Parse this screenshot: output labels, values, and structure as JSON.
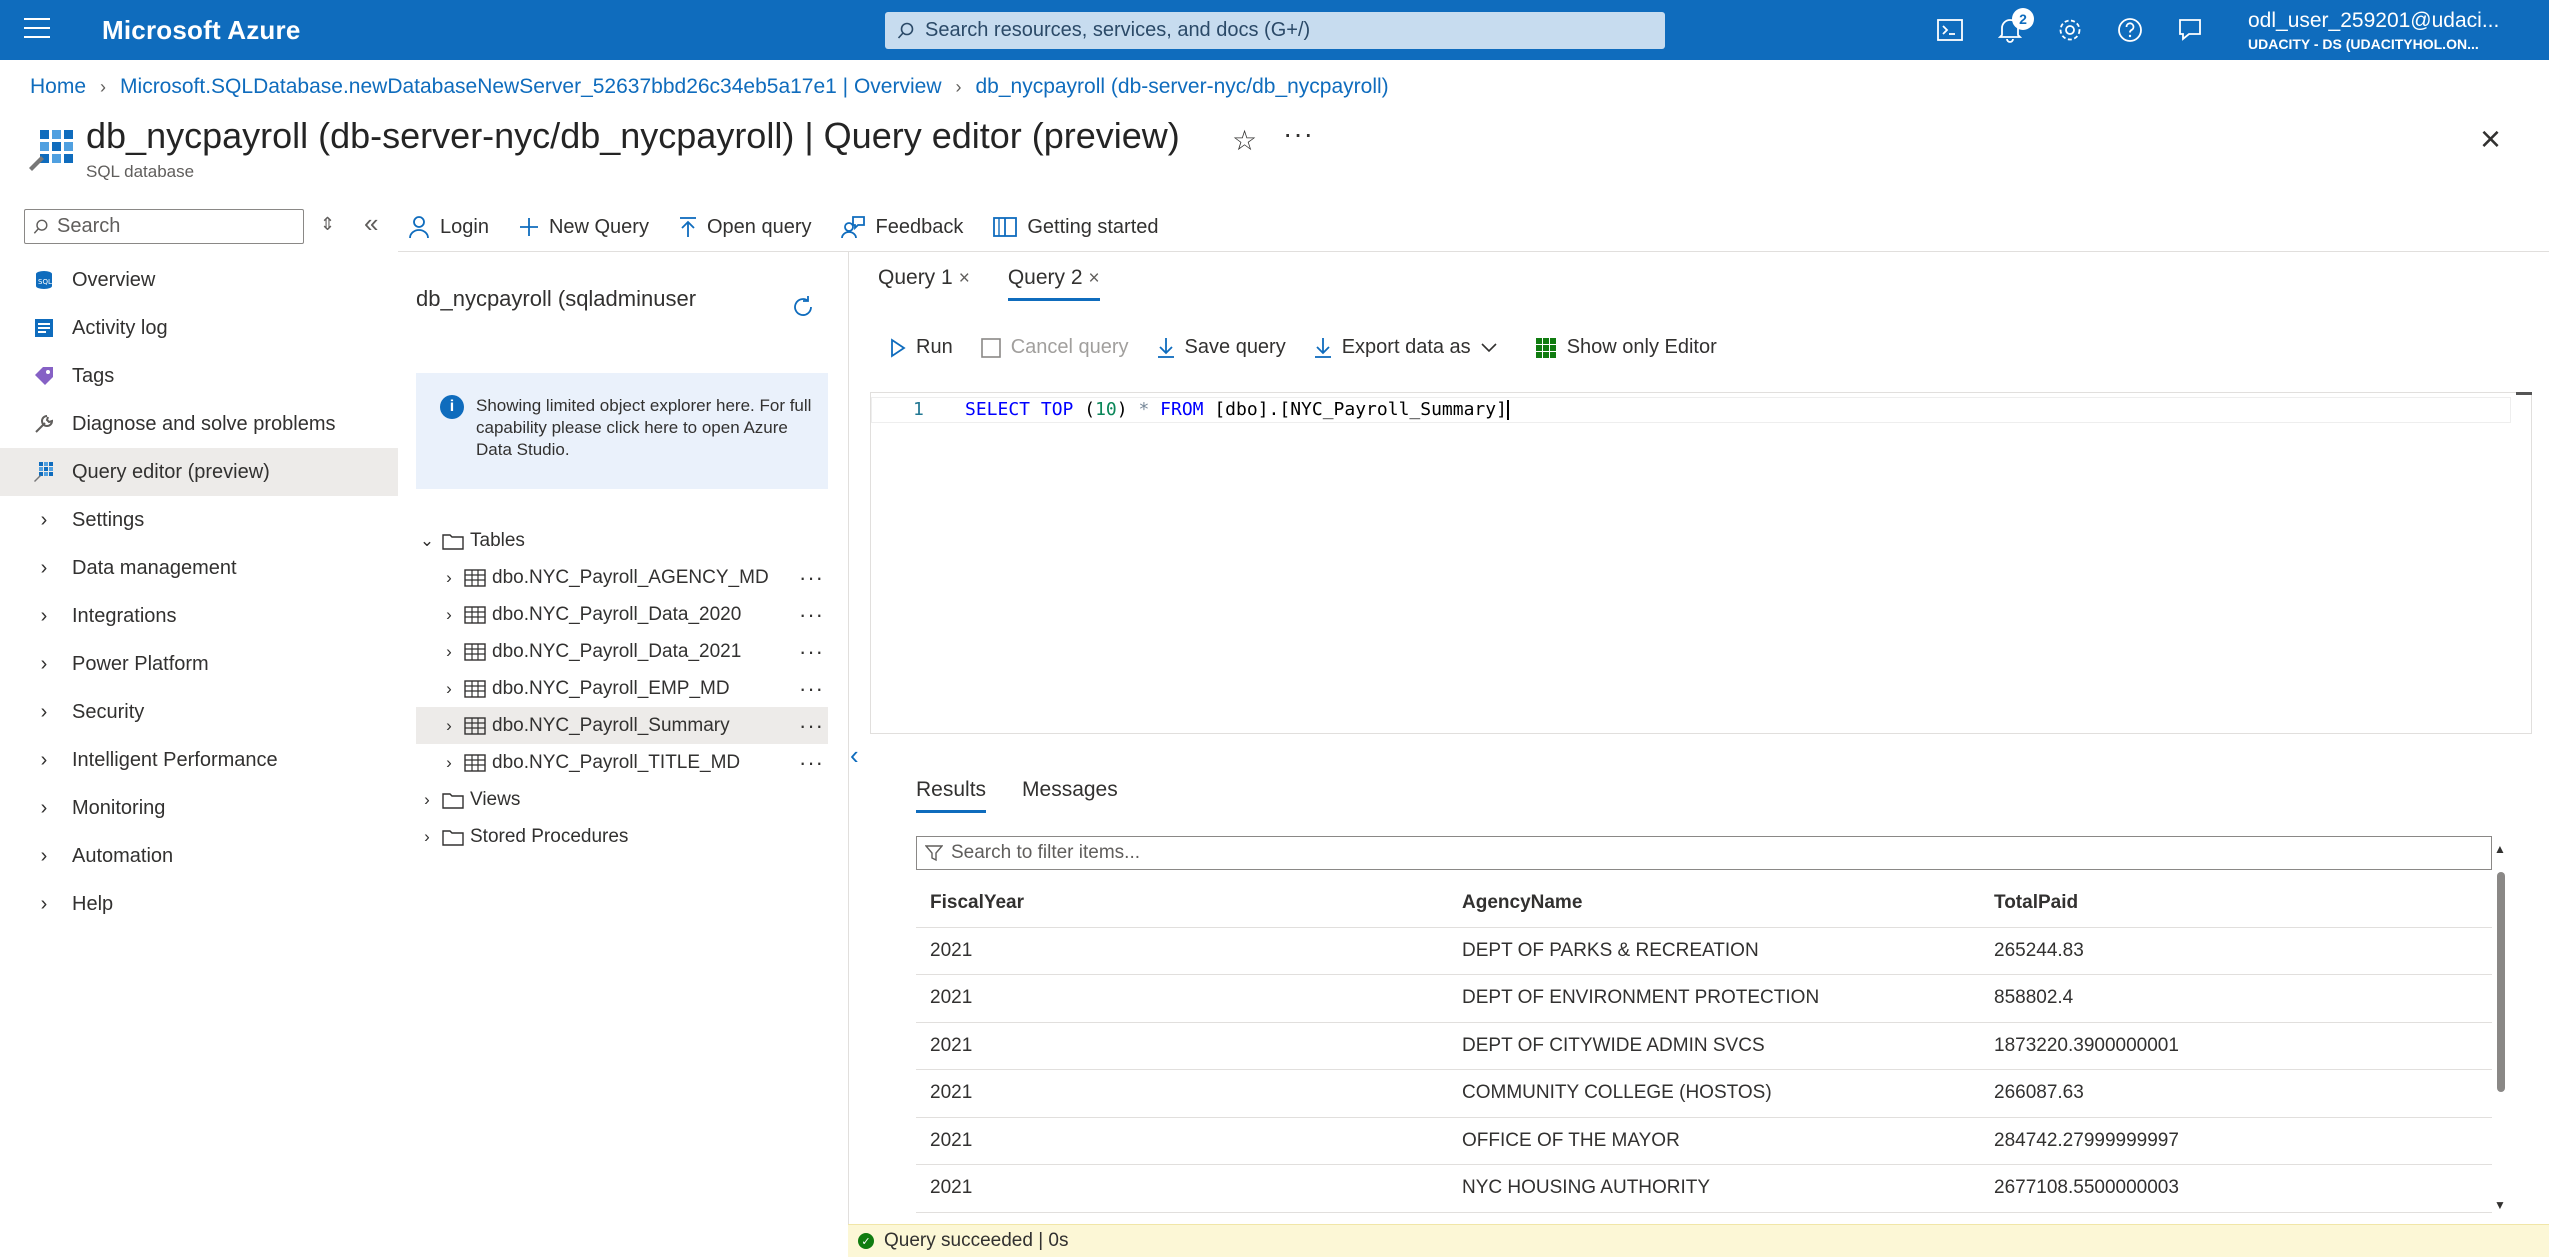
{
  "topbar": {
    "brand": "Microsoft Azure",
    "search_placeholder": "Search resources, services, and docs (G+/)",
    "notification_count": "2",
    "user": "odl_user_259201@udaci...",
    "tenant": "UDACITY - DS (UDACITYHOL.ON..."
  },
  "breadcrumb": {
    "home": "Home",
    "server": "Microsoft.SQLDatabase.newDatabaseNewServer_52637bbd26c34eb5a17e1 | Overview",
    "db": "db_nycpayroll (db-server-nyc/db_nycpayroll)"
  },
  "header": {
    "title": "db_nycpayroll (db-server-nyc/db_nycpayroll) | Query editor (preview)",
    "subtitle": "SQL database"
  },
  "nav": {
    "search_placeholder": "Search",
    "items": [
      {
        "label": "Overview"
      },
      {
        "label": "Activity log"
      },
      {
        "label": "Tags"
      },
      {
        "label": "Diagnose and solve problems"
      },
      {
        "label": "Query editor (preview)"
      },
      {
        "label": "Settings"
      },
      {
        "label": "Data management"
      },
      {
        "label": "Integrations"
      },
      {
        "label": "Power Platform"
      },
      {
        "label": "Security"
      },
      {
        "label": "Intelligent Performance"
      },
      {
        "label": "Monitoring"
      },
      {
        "label": "Automation"
      },
      {
        "label": "Help"
      }
    ]
  },
  "toolbar": {
    "login": "Login",
    "new_query": "New Query",
    "open_query": "Open query",
    "feedback": "Feedback",
    "getting_started": "Getting started"
  },
  "explorer": {
    "title": "db_nycpayroll (sqladminuser",
    "info": "Showing limited object explorer here. For full capability please click here to open Azure Data Studio.",
    "tables_label": "Tables",
    "tables": [
      {
        "name": "dbo.NYC_Payroll_AGENCY_MD"
      },
      {
        "name": "dbo.NYC_Payroll_Data_2020"
      },
      {
        "name": "dbo.NYC_Payroll_Data_2021"
      },
      {
        "name": "dbo.NYC_Payroll_EMP_MD"
      },
      {
        "name": "dbo.NYC_Payroll_Summary"
      },
      {
        "name": "dbo.NYC_Payroll_TITLE_MD"
      }
    ],
    "views_label": "Views",
    "procs_label": "Stored Procedures"
  },
  "query_tabs": [
    {
      "label": "Query 1"
    },
    {
      "label": "Query 2"
    }
  ],
  "query_toolbar": {
    "run": "Run",
    "cancel": "Cancel query",
    "save": "Save query",
    "export": "Export data as",
    "show_editor": "Show only Editor"
  },
  "editor": {
    "line_number": "1",
    "kw_select": "SELECT",
    "kw_top": "TOP",
    "paren_open": "(",
    "num": "10",
    "paren_close": ")",
    "star": "*",
    "kw_from": "FROM",
    "object": "[dbo].[NYC_Payroll_Summary]"
  },
  "results": {
    "tab_results": "Results",
    "tab_messages": "Messages",
    "filter_placeholder": "Search to filter items...",
    "columns": [
      "FiscalYear",
      "AgencyName",
      "TotalPaid"
    ],
    "rows": [
      [
        "2021",
        "DEPT OF PARKS & RECREATION",
        "265244.83"
      ],
      [
        "2021",
        "DEPT OF ENVIRONMENT PROTECTION",
        "858802.4"
      ],
      [
        "2021",
        "DEPT OF CITYWIDE ADMIN SVCS",
        "1873220.3900000001"
      ],
      [
        "2021",
        "COMMUNITY COLLEGE (HOSTOS)",
        "266087.63"
      ],
      [
        "2021",
        "OFFICE OF THE MAYOR",
        "284742.27999999997"
      ],
      [
        "2021",
        "NYC HOUSING AUTHORITY",
        "2677108.5500000003"
      ]
    ]
  },
  "status": {
    "text": "Query succeeded | 0s"
  },
  "colors": {
    "accent": "#0f6cbd",
    "status_bg": "#fcf7d6",
    "success": "#107c10"
  }
}
